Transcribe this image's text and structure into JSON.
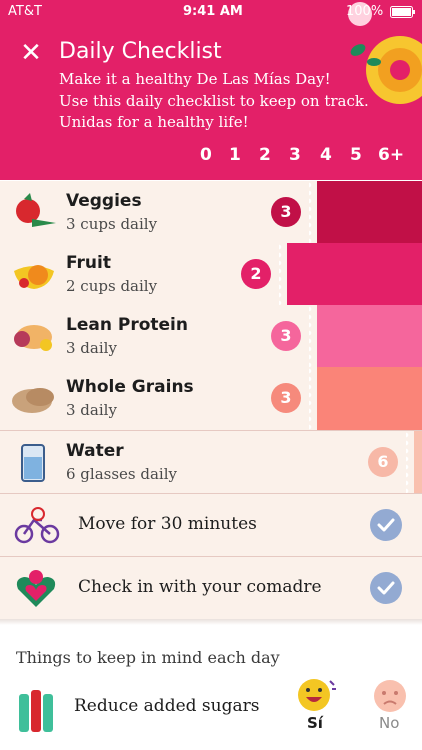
{
  "status_bar": {
    "carrier": "AT&T",
    "time": "9:41 AM",
    "battery": "100%"
  },
  "header": {
    "title": "Daily Checklist",
    "lines": [
      "Make it a healthy De Las Mías Day!",
      "Use this daily checklist to keep on track.",
      "Unidas for a healthy life!"
    ],
    "scale": [
      "0",
      "1",
      "2",
      "3",
      "4",
      "5",
      "6+"
    ],
    "colors": {
      "background": "#e32068"
    }
  },
  "checklist": {
    "items": [
      {
        "title": "Veggies",
        "subtitle": "3 cups daily",
        "count": "3",
        "icon": "veggies-icon",
        "progress": 0.5,
        "bar_color": "#c11047",
        "badge_color": "#c11047"
      },
      {
        "title": "Fruit",
        "subtitle": "2 cups daily",
        "count": "2",
        "icon": "fruit-icon",
        "progress": 0.33,
        "bar_color": "#e32068",
        "badge_color": "#e32068"
      },
      {
        "title": "Lean Protein",
        "subtitle": "3 daily",
        "count": "3",
        "icon": "lean-protein-icon",
        "progress": 0.5,
        "bar_color": "#f5669c",
        "badge_color": "#f5669c"
      },
      {
        "title": "Whole Grains",
        "subtitle": "3 daily",
        "count": "3",
        "icon": "whole-grains-icon",
        "progress": 0.5,
        "bar_color": "#fa8478",
        "badge_color": "#f68a7c"
      },
      {
        "title": "Water",
        "subtitle": "6 glasses daily",
        "count": "6",
        "icon": "water-icon",
        "progress": 1.0,
        "bar_color": "#f9c0ae",
        "badge_color": "#f7b8a7"
      }
    ],
    "tasks": [
      {
        "label": "Move for 30 minutes",
        "icon": "bicycle-icon",
        "done": true
      },
      {
        "label": "Check in with your comadre",
        "icon": "heart-flower-icon",
        "done": true
      }
    ]
  },
  "tips": {
    "title": "Things to keep in mind each day",
    "items": [
      {
        "label": "Reduce added sugars",
        "yes": "Sí",
        "no": "No",
        "icon": "soda-bottles-icon"
      }
    ]
  }
}
